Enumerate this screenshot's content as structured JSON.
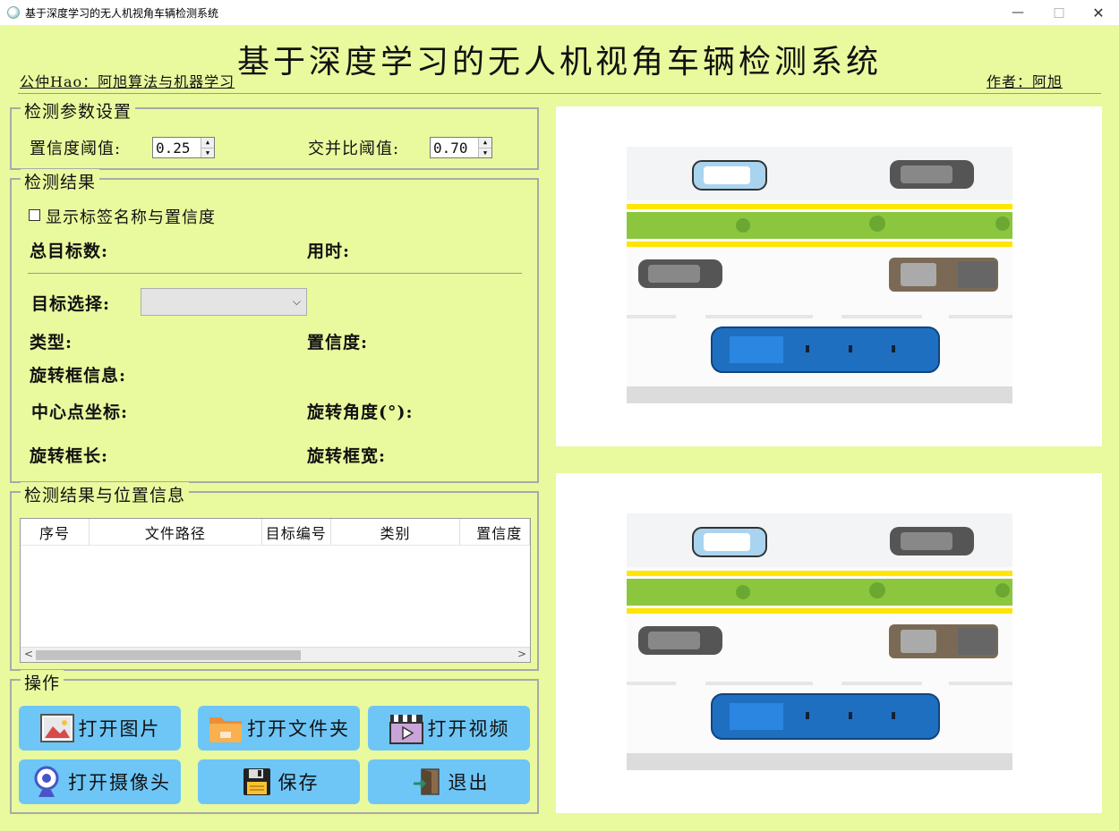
{
  "window": {
    "title": "基于深度学习的无人机视角车辆检测系统",
    "controls": {
      "minimize": "—",
      "maximize": "□",
      "close": "✕"
    }
  },
  "header": {
    "title": "基于深度学习的无人机视角车辆检测系统",
    "left_caption": "公仲Hao：阿旭算法与机器学习",
    "right_caption": "作者：阿旭"
  },
  "params": {
    "group_title": "检测参数设置",
    "conf_label": "置信度阈值:",
    "conf_value": "0.25",
    "iou_label": "交并比阈值:",
    "iou_value": "0.70"
  },
  "results": {
    "group_title": "检测结果",
    "show_label_checkbox": "显示标签名称与置信度",
    "total_targets": "总目标数:",
    "elapsed_time": "用时:",
    "target_select": "目标选择:",
    "type": "类型:",
    "confidence": "置信度:",
    "rotbox_info": "旋转框信息:",
    "center": "中心点坐标:",
    "angle": "旋转角度(°):",
    "box_length": "旋转框长:",
    "box_width": "旋转框宽:"
  },
  "table": {
    "group_title": "检测结果与位置信息",
    "columns": [
      "序号",
      "文件路径",
      "目标编号",
      "类别",
      "置信度"
    ]
  },
  "ops": {
    "group_title": "操作",
    "open_image": "打开图片",
    "open_folder": "打开文件夹",
    "open_video": "打开视频",
    "open_camera": "打开摄像头",
    "save": "保存",
    "exit": "退出"
  },
  "colors": {
    "background": "#e9f99e",
    "button": "#6ec6f7",
    "bus": "#1f6fc1",
    "median": "#8cc63f",
    "lane_yellow": "#ffe500"
  }
}
